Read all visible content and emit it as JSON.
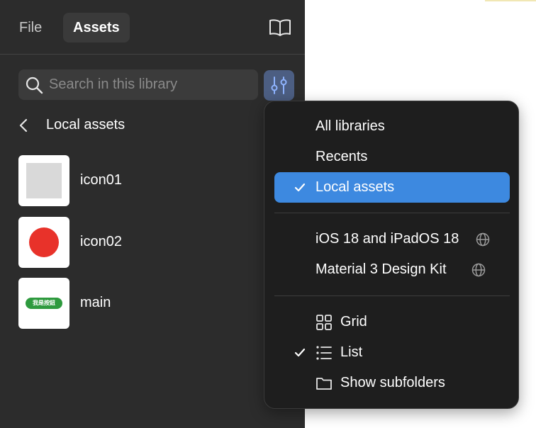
{
  "tabs": [
    {
      "label": "File",
      "active": false
    },
    {
      "label": "Assets",
      "active": true
    }
  ],
  "search": {
    "placeholder": "Search in this library",
    "value": ""
  },
  "breadcrumb": {
    "label": "Local assets"
  },
  "assets": [
    {
      "name": "icon01",
      "thumb": "gray-square"
    },
    {
      "name": "icon02",
      "thumb": "red-circle"
    },
    {
      "name": "main",
      "thumb": "green-button",
      "thumb_text": "我是按鈕"
    }
  ],
  "library_menu": {
    "sources": [
      {
        "label": "All libraries",
        "selected": false
      },
      {
        "label": "Recents",
        "selected": false
      },
      {
        "label": "Local assets",
        "selected": true
      }
    ],
    "libraries": [
      {
        "label": "iOS 18 and iPadOS 18",
        "icon": "globe-icon"
      },
      {
        "label": "Material 3 Design Kit",
        "icon": "globe-icon"
      }
    ],
    "views": [
      {
        "label": "Grid",
        "icon": "grid-icon",
        "checked": false
      },
      {
        "label": "List",
        "icon": "list-icon",
        "checked": true
      },
      {
        "label": "Show subfolders",
        "icon": "folder-icon",
        "checked": false
      }
    ]
  },
  "colors": {
    "panel_bg": "#2c2c2c",
    "menu_bg": "#1e1e1e",
    "accent": "#3d89e0",
    "filter_button_bg": "#4c5e82",
    "thumb_red": "#e8322a",
    "thumb_green": "#2e9a3e"
  }
}
